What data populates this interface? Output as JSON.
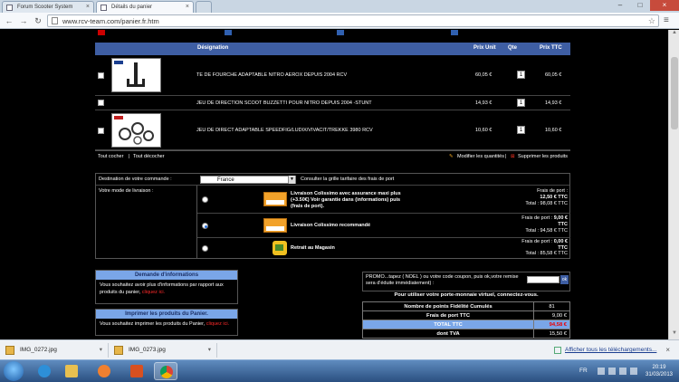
{
  "browser": {
    "tabs": [
      {
        "label": "Forum Scooter System",
        "active": false
      },
      {
        "label": "Détails du panier",
        "active": true
      }
    ],
    "url": "www.rcv-team.com/panier.fr.htm",
    "icons": [
      "back-icon",
      "forward-icon",
      "reload-icon",
      "star-icon",
      "menu-icon"
    ]
  },
  "cart": {
    "headers": {
      "designation": "Désignation",
      "price_unit": "Prix Unit",
      "qty": "Qte",
      "price_ttc": "Prix TTC"
    },
    "rows": [
      {
        "name": "TE DE FOURCHE ADAPTABLE NITRO AEROX DEPUIS 2004 RCV",
        "unit": "60,05 €",
        "qty": "1",
        "total": "60,05 €",
        "has_image": true
      },
      {
        "name": "JEU DE DIRECTION SCOOT BUZZETTI POUR NITRO DEPUIS 2004 -STUNT",
        "unit": "14,93 €",
        "qty": "1",
        "total": "14,93 €",
        "has_image": false
      },
      {
        "name": "JEU DE DIRECT ADAPTABLE SPEEDFIG/LUDIX/VIVACIT/TREKKE 3980 RCV",
        "unit": "10,60 €",
        "qty": "1",
        "total": "10,60 €",
        "has_image": true
      }
    ],
    "footer": {
      "check_all": "Tout cocher",
      "sep": "|",
      "uncheck_all": "Tout décocher",
      "update_qty": "Modifier les quantités",
      "delete_products": "Supprimer les produits"
    }
  },
  "delivery": {
    "destination_label": "Destination de votre commande :",
    "destination_value": "France",
    "rates_link": "Consulter la grille tarifaire des frais de port",
    "mode_label": "Votre mode de livraison :",
    "options": [
      {
        "title": "Livraison Colissimo avec assurance maxi plus (+3.50€) Voir garantie dans (informations) puis (frais de port).",
        "fee_label": "Frais de port :",
        "fee": "12,50 € TTC",
        "total": "Total : 98,08 € TTC",
        "selected": false
      },
      {
        "title": "Livraison Colissimo recommandé",
        "fee_label": "Frais de port :",
        "fee": "9,00 € TTC",
        "total": "Total : 94,58 € TTC",
        "selected": true
      },
      {
        "title": "Retrait au Magasin",
        "fee_label": "Frais de port :",
        "fee": "0,00 € TTC",
        "total": "Total : 85,58 € TTC",
        "selected": false
      }
    ]
  },
  "info_panel": {
    "title": "Demande d'informations",
    "text": "Vous souhaitez avoir plus d'informations par rapport aux produits du panier,",
    "link": "cliquez ici."
  },
  "print_panel": {
    "title": "Imprimer les produits du Panier.",
    "text": "Vous souhaitez imprimer les produits du Panier,",
    "link": "cliquez ici."
  },
  "promo": {
    "text": "PROMO...tapez ( NOEL ) ou votre code coupon, puis ok,votre remise sera d'éduite immédiatement) :",
    "ok": "ok"
  },
  "wallet_text": "Pour utiliser votre porte-monnaie virtuel, connectez-vous.",
  "totals": [
    {
      "label": "Nombre de points Fidélité Cumulés",
      "value": "81",
      "highlight": false
    },
    {
      "label": "Frais de port TTC",
      "value": "9,00 €",
      "highlight": false
    },
    {
      "label": "TOTAL TTC",
      "value": "94,58 €",
      "highlight": true
    },
    {
      "label": "dont TVA",
      "value": "15,50 €",
      "highlight": false
    }
  ],
  "downloads": {
    "items": [
      "IMG_0272.jpg",
      "IMG_0273.jpg"
    ],
    "show_all": "Afficher tous les téléchargements...",
    "close": "×"
  },
  "taskbar": {
    "language": "FR",
    "time": "20:19",
    "date": "31/03/2013"
  }
}
